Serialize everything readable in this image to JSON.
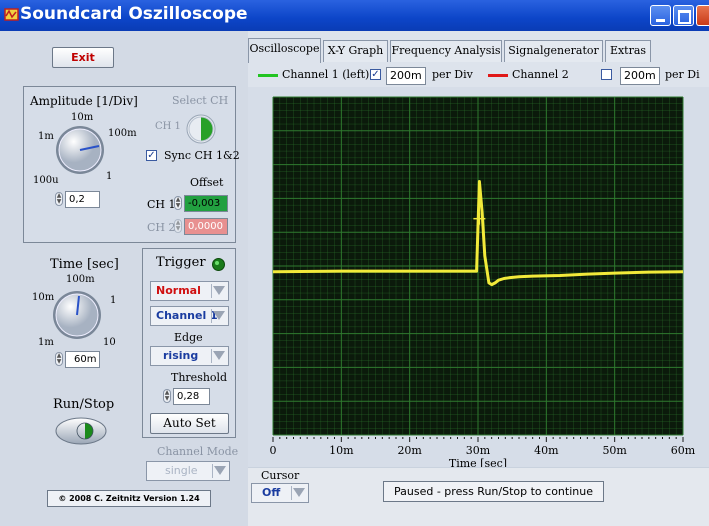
{
  "window": {
    "title": "Soundcard Oszilloscope"
  },
  "left": {
    "exit_label": "Exit",
    "amplitude": {
      "title": "Amplitude [1/Div]",
      "knob_labels": {
        "top": "10m",
        "left_upper": "1m",
        "right_upper": "100m",
        "left_lower": "100u",
        "right_lower": "1"
      },
      "value": "0,2"
    },
    "select_ch": {
      "title": "Select CH",
      "ch1_label": "CH 1"
    },
    "sync": {
      "label": "Sync CH 1&2",
      "checked": true
    },
    "offset": {
      "title": "Offset",
      "ch1_label": "CH 1",
      "ch1_value": "-0,003",
      "ch2_label": "CH 2",
      "ch2_value": "0,0000"
    },
    "time": {
      "title": "Time [sec]",
      "knob_labels": {
        "top": "100m",
        "left_upper": "10m",
        "right_upper": "1",
        "left_lower": "1m",
        "right_lower": "10"
      },
      "value": "60m"
    },
    "trigger": {
      "title": "Trigger",
      "mode": "Normal",
      "channel": "Channel 1",
      "edge_title": "Edge",
      "edge": "rising",
      "threshold_title": "Threshold",
      "threshold": "0,28",
      "autoset_label": "Auto Set"
    },
    "run_stop": {
      "label": "Run/Stop"
    },
    "channel_mode": {
      "title": "Channel Mode",
      "value": "single"
    },
    "copyright": "© 2008  C. Zeitnitz Version 1.24"
  },
  "tabs": [
    {
      "label": "Oscilloscope",
      "active": true
    },
    {
      "label": "X-Y Graph",
      "active": false
    },
    {
      "label": "Frequency Analysis",
      "active": false
    },
    {
      "label": "Signalgenerator",
      "active": false
    },
    {
      "label": "Extras",
      "active": false
    }
  ],
  "channel_bar": {
    "ch1_label": "Channel 1 (left)",
    "ch1_checked": true,
    "ch1_div": "200m",
    "per_div": "per Div",
    "ch2_label": "Channel 2",
    "ch2_checked": false,
    "ch2_div": "200m",
    "ch2_per_div": "per Di",
    "ch1_color": "#22c422",
    "ch2_color": "#e01818"
  },
  "cursor": {
    "title": "Cursor",
    "value": "Off"
  },
  "status": "Paused - press Run/Stop to continue",
  "chart_data": {
    "type": "line",
    "xlabel": "Time [sec]",
    "ylabel": "",
    "xlim": [
      0,
      60
    ],
    "ylim": [
      -5,
      5
    ],
    "x_ticks": [
      "0",
      "10m",
      "20m",
      "30m",
      "40m",
      "50m",
      "60m"
    ],
    "grid": true,
    "background": "#0b1a0b",
    "grid_color": "#2f7a2f",
    "trace_color": "#f2ea3a",
    "series": [
      {
        "x": [
          0,
          10,
          20,
          29.8,
          30.2,
          30.6,
          31,
          31.6,
          32,
          32.5,
          33,
          33.8,
          34.5,
          36,
          38,
          42,
          46,
          50,
          55,
          60
        ],
        "y": [
          -0.17,
          -0.15,
          -0.15,
          -0.15,
          2.5,
          1.6,
          0.3,
          -0.5,
          -0.55,
          -0.5,
          -0.42,
          -0.37,
          -0.35,
          -0.32,
          -0.3,
          -0.28,
          -0.24,
          -0.21,
          -0.18,
          -0.17
        ]
      }
    ],
    "trigger_marker": {
      "x": 30.2,
      "y": 1.4
    }
  }
}
